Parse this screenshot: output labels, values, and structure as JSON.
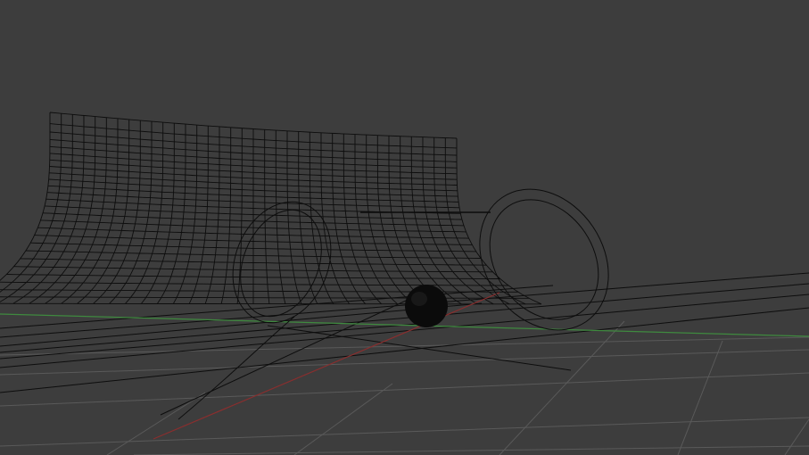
{
  "viewport": {
    "view": "3d-perspective-wireframe",
    "background_color": "#3d3d3d",
    "grid_color": "#5a5a5a",
    "wire_color": "#0d0d0d",
    "x_axis_color": "#8a2e2e",
    "y_axis_color": "#3f8a3f"
  },
  "scene": {
    "objects": [
      {
        "name": "flared-tube-mesh",
        "display": "wireframe"
      },
      {
        "name": "ground-plane-mesh",
        "display": "wireframe"
      },
      {
        "name": "sphere",
        "display": "solid",
        "color": "#0b0b0b"
      },
      {
        "name": "torus-ring-left",
        "display": "wireframe"
      },
      {
        "name": "torus-ring-right",
        "display": "wireframe"
      },
      {
        "name": "camera-crosshair",
        "display": "wireframe"
      }
    ]
  }
}
